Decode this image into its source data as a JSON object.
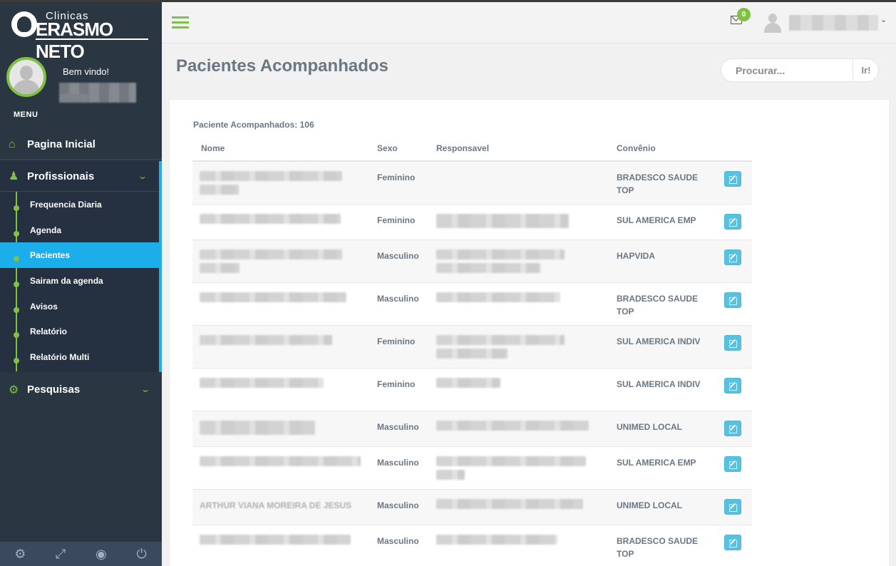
{
  "app": {
    "logo_top": "Clinicas",
    "logo_brand": "ERASMO NETO"
  },
  "user": {
    "welcome": "Bem vindo!"
  },
  "sidebar": {
    "menu_label": "MENU",
    "home": "Pagina Inicial",
    "profissionais": "Profissionais",
    "sub_items": [
      "Frequencia Diaria",
      "Agenda",
      "Pacientes",
      "Sairam da agenda",
      "Avisos",
      "Relatório",
      "Relatório Multi"
    ],
    "active_index": 2,
    "pesquisas": "Pesquisas",
    "bottom_icons": [
      "gear-icon",
      "fullscreen-icon",
      "eye-slash-icon",
      "power-icon"
    ]
  },
  "header": {
    "notification_count": "0"
  },
  "page": {
    "title": "Pacientes Acompanhados",
    "search_placeholder": "Procurar...",
    "search_button": "Ir!",
    "count_label": "Paciente Acompanhados: 106"
  },
  "table": {
    "columns": [
      "Nome",
      "Sexo",
      "Responsavel",
      "Convênio"
    ],
    "rows": [
      {
        "nome": "",
        "sexo": "Feminino",
        "convenio": "BRADESCO SAUDE TOP"
      },
      {
        "nome": "",
        "sexo": "Feminino",
        "convenio": "SUL AMERICA EMP"
      },
      {
        "nome": "",
        "sexo": "Masculino",
        "convenio": "HAPVIDA"
      },
      {
        "nome": "",
        "sexo": "Masculino",
        "convenio": "BRADESCO SAUDE TOP"
      },
      {
        "nome": "",
        "sexo": "Feminino",
        "convenio": "SUL AMERICA INDIV"
      },
      {
        "nome": "",
        "sexo": "Feminino",
        "convenio": "SUL AMERICA INDIV"
      },
      {
        "nome": "",
        "sexo": "Masculino",
        "convenio": "UNIMED LOCAL"
      },
      {
        "nome": "",
        "sexo": "Masculino",
        "convenio": "SUL AMERICA EMP"
      },
      {
        "nome": "ARTHUR VIANA MOREIRA DE JESUS",
        "sexo": "Masculino",
        "convenio": "UNIMED LOCAL"
      },
      {
        "nome": "",
        "sexo": "Masculino",
        "convenio": "BRADESCO SAUDE TOP"
      }
    ]
  },
  "colors": {
    "sidebar_bg": "#2b3643",
    "accent_green": "#7fc142",
    "active_blue": "#1caeeb",
    "edit_button": "#5bc0de"
  }
}
